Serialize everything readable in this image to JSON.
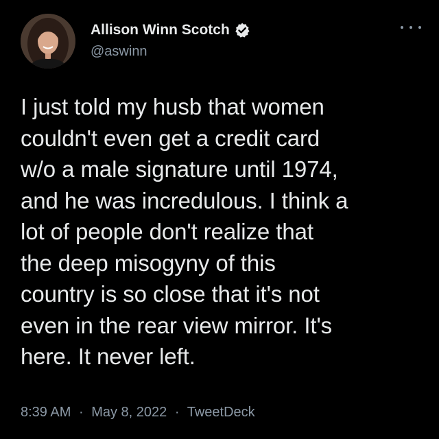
{
  "author": {
    "display_name": "Allison Winn Scotch",
    "handle": "@aswinn",
    "verified_icon": "verified-badge-icon",
    "avatar_icon": "profile-photo"
  },
  "more_icon": "more-options-icon",
  "tweet": {
    "lines": [
      "I just told my husb that women",
      "couldn't even get a credit card",
      "w/o a male signature until 1974,",
      "and he was incredulous. I think a",
      "lot of people don't realize that",
      "the deep misogyny of this",
      "country is so close that it's not",
      "even in the rear view mirror. It's",
      "here. It never left."
    ]
  },
  "meta": {
    "time": "8:39 AM",
    "separator": "·",
    "date": "May 8, 2022",
    "source": "TweetDeck"
  },
  "colors": {
    "background": "#000000",
    "text": "#e7e9ea",
    "secondary": "#8b98a5",
    "verified_badge": "#e7e9ea"
  }
}
